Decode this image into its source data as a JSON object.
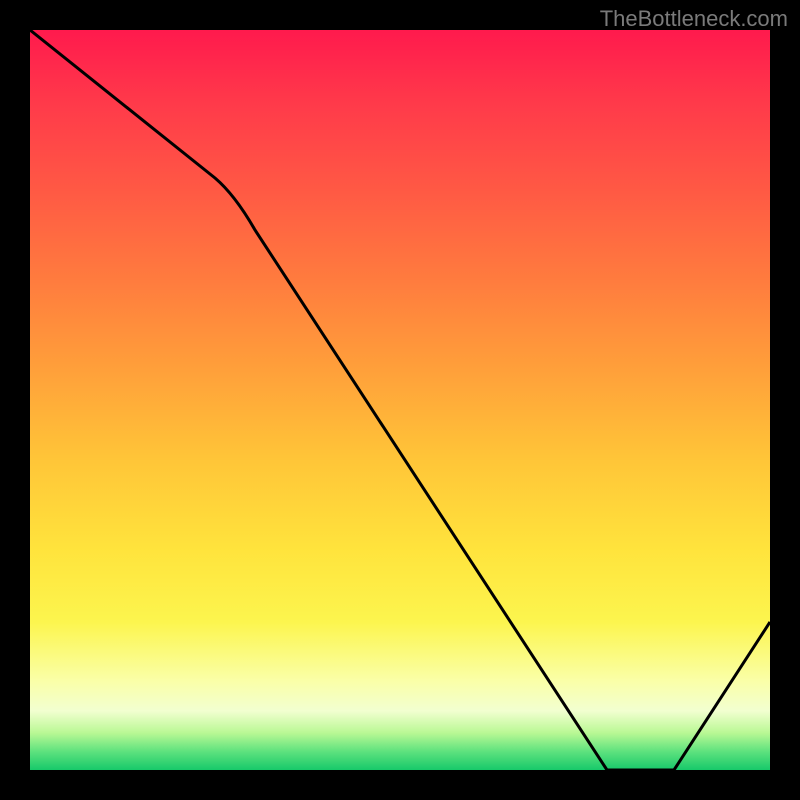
{
  "attribution": "TheBottleneck.com",
  "marker_label": "",
  "chart_data": {
    "type": "line",
    "title": "",
    "xlabel": "",
    "ylabel": "",
    "xlim": [
      0,
      100
    ],
    "ylim": [
      0,
      100
    ],
    "grid": false,
    "legend": false,
    "series": [
      {
        "name": "bottleneck-curve",
        "x": [
          0,
          25,
          78,
          87,
          100
        ],
        "values": [
          100,
          80,
          0,
          0,
          20
        ]
      }
    ],
    "annotations": [
      {
        "name": "optimal-zone",
        "x": 82,
        "y": 2,
        "text": ""
      }
    ]
  }
}
